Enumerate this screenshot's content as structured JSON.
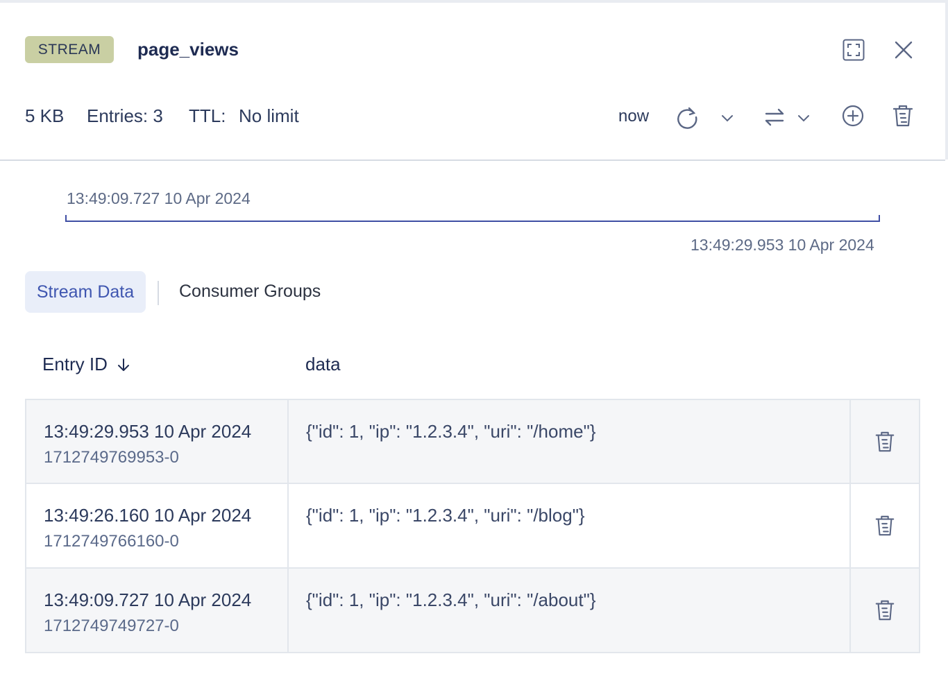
{
  "header": {
    "type_badge": "STREAM",
    "key_name": "page_views",
    "size": "5 KB",
    "entries": "Entries: 3",
    "ttl_label": "TTL:",
    "ttl_value": "No limit",
    "refresh_label": "now"
  },
  "range": {
    "start": "13:49:09.727 10 Apr 2024",
    "end": "13:49:29.953 10 Apr 2024"
  },
  "tabs": [
    {
      "label": "Stream Data",
      "active": true
    },
    {
      "label": "Consumer Groups",
      "active": false
    }
  ],
  "table": {
    "columns": [
      "Entry ID",
      "data"
    ],
    "rows": [
      {
        "timestamp": "13:49:29.953 10 Apr 2024",
        "id": "1712749769953-0",
        "data": "{\"id\": 1, \"ip\": \"1.2.3.4\", \"uri\": \"/home\"}"
      },
      {
        "timestamp": "13:49:26.160 10 Apr 2024",
        "id": "1712749766160-0",
        "data": "{\"id\": 1, \"ip\": \"1.2.3.4\", \"uri\": \"/blog\"}"
      },
      {
        "timestamp": "13:49:09.727 10 Apr 2024",
        "id": "1712749749727-0",
        "data": "{\"id\": 1, \"ip\": \"1.2.3.4\", \"uri\": \"/about\"}"
      }
    ]
  },
  "icons": {
    "fullscreen": "fullscreen-icon",
    "close": "close-icon",
    "refresh": "refresh-icon",
    "chevron": "chevron-down-icon",
    "sort": "arrows-swap-icon",
    "add": "plus-circle-icon",
    "delete": "trash-icon",
    "sort_dir": "arrow-down-icon"
  },
  "colors": {
    "badge_bg": "#c9cfa3",
    "accent": "#3f56b0",
    "tab_active_bg": "#e9eef9"
  }
}
